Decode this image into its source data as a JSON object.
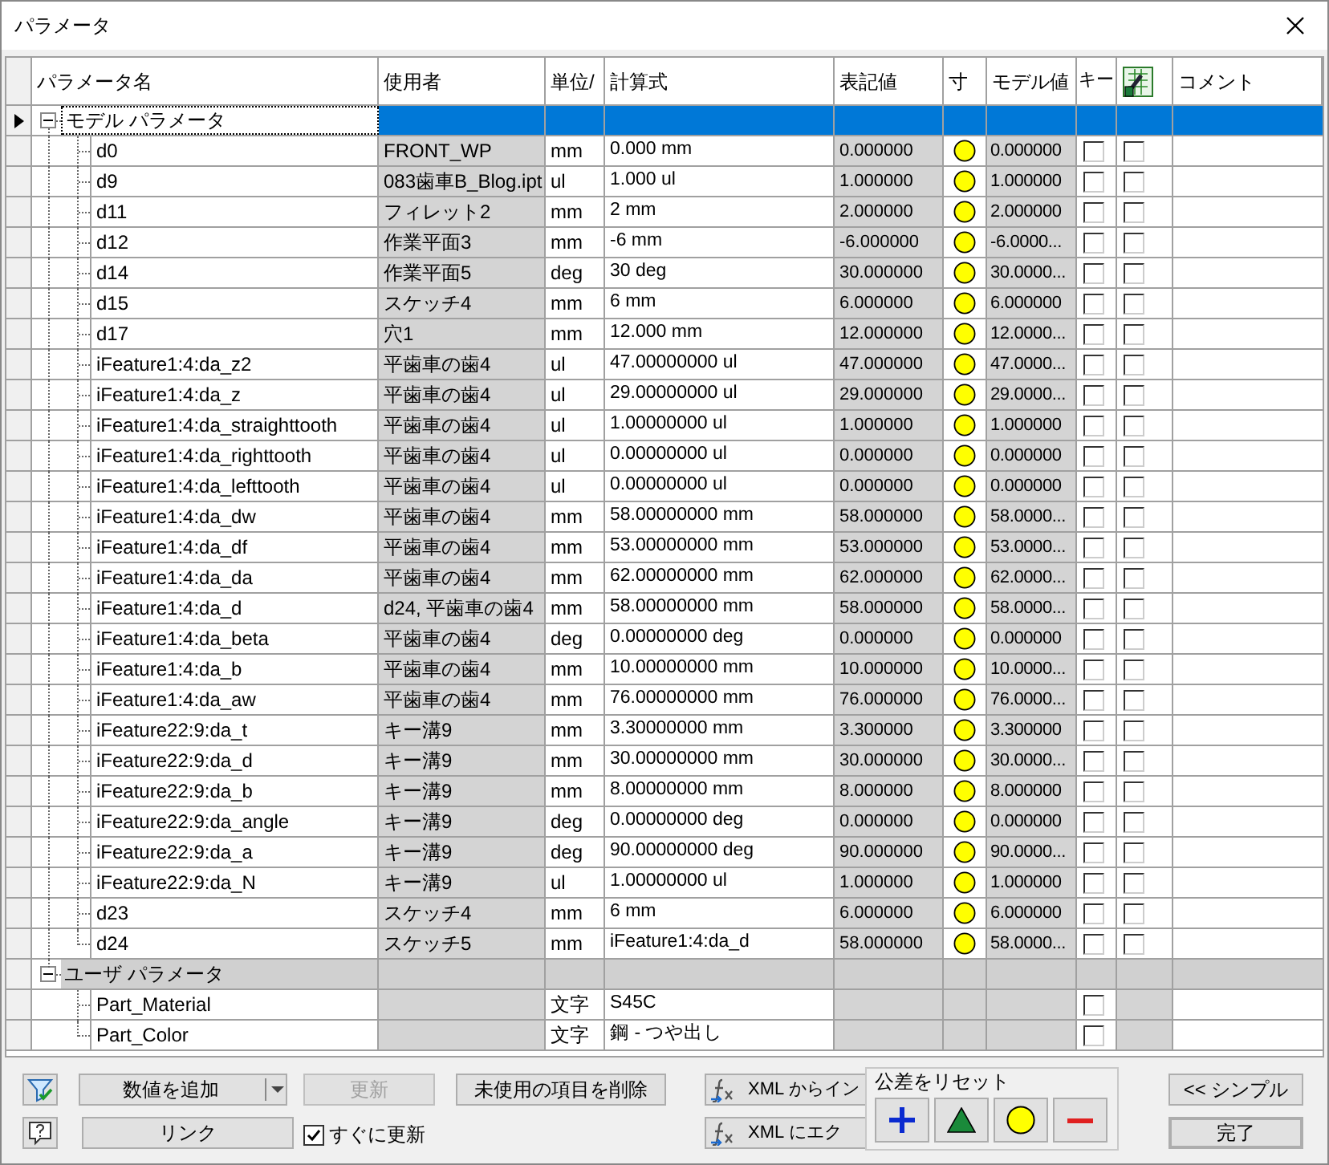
{
  "window": {
    "title": "パラメータ"
  },
  "columns": [
    {
      "label": "パラメータ名"
    },
    {
      "label": "使用者"
    },
    {
      "label": "単位/"
    },
    {
      "label": "計算式"
    },
    {
      "label": "表記値"
    },
    {
      "label": "寸"
    },
    {
      "label": "モデル値"
    },
    {
      "label": "キー"
    },
    {
      "kind": "export_icon"
    },
    {
      "label": "コメント"
    }
  ],
  "groups": [
    {
      "label": "モデル パラメータ",
      "expanded": true,
      "selected": true,
      "rows": [
        {
          "kind": "numeric",
          "name": "d0",
          "user": "FRONT_WP",
          "unit": "mm",
          "formula": "0.000 mm",
          "display_value": "0.000000",
          "model_value": "0.000000",
          "key": false,
          "export": false
        },
        {
          "kind": "numeric",
          "name": "d9",
          "user": "083歯車B_Blog.ipt",
          "unit": "ul",
          "formula": "1.000 ul",
          "display_value": "1.000000",
          "model_value": "1.000000",
          "key": false,
          "export": false
        },
        {
          "kind": "numeric",
          "name": "d11",
          "user": "フィレット2",
          "unit": "mm",
          "formula": "2 mm",
          "display_value": "2.000000",
          "model_value": "2.000000",
          "key": false,
          "export": false
        },
        {
          "kind": "numeric",
          "name": "d12",
          "user": "作業平面3",
          "unit": "mm",
          "formula": "-6 mm",
          "display_value": "-6.000000",
          "model_value": "-6.0000...",
          "key": false,
          "export": false
        },
        {
          "kind": "numeric",
          "name": "d14",
          "user": "作業平面5",
          "unit": "deg",
          "formula": "30 deg",
          "display_value": "30.000000",
          "model_value": "30.0000...",
          "key": false,
          "export": false
        },
        {
          "kind": "numeric",
          "name": "d15",
          "user": "スケッチ4",
          "unit": "mm",
          "formula": "6 mm",
          "display_value": "6.000000",
          "model_value": "6.000000",
          "key": false,
          "export": false
        },
        {
          "kind": "numeric",
          "name": "d17",
          "user": "穴1",
          "unit": "mm",
          "formula": "12.000 mm",
          "display_value": "12.000000",
          "model_value": "12.0000...",
          "key": false,
          "export": false
        },
        {
          "kind": "numeric",
          "name": "iFeature1:4:da_z2",
          "user": "平歯車の歯4",
          "unit": "ul",
          "formula": "47.00000000 ul",
          "display_value": "47.000000",
          "model_value": "47.0000...",
          "key": false,
          "export": false
        },
        {
          "kind": "numeric",
          "name": "iFeature1:4:da_z",
          "user": "平歯車の歯4",
          "unit": "ul",
          "formula": "29.00000000 ul",
          "display_value": "29.000000",
          "model_value": "29.0000...",
          "key": false,
          "export": false
        },
        {
          "kind": "numeric",
          "name": "iFeature1:4:da_straighttooth",
          "user": "平歯車の歯4",
          "unit": "ul",
          "formula": "1.00000000 ul",
          "display_value": "1.000000",
          "model_value": "1.000000",
          "key": false,
          "export": false
        },
        {
          "kind": "numeric",
          "name": "iFeature1:4:da_righttooth",
          "user": "平歯車の歯4",
          "unit": "ul",
          "formula": "0.00000000 ul",
          "display_value": "0.000000",
          "model_value": "0.000000",
          "key": false,
          "export": false
        },
        {
          "kind": "numeric",
          "name": "iFeature1:4:da_lefttooth",
          "user": "平歯車の歯4",
          "unit": "ul",
          "formula": "0.00000000 ul",
          "display_value": "0.000000",
          "model_value": "0.000000",
          "key": false,
          "export": false
        },
        {
          "kind": "numeric",
          "name": "iFeature1:4:da_dw",
          "user": "平歯車の歯4",
          "unit": "mm",
          "formula": "58.00000000 mm",
          "display_value": "58.000000",
          "model_value": "58.0000...",
          "key": false,
          "export": false
        },
        {
          "kind": "numeric",
          "name": "iFeature1:4:da_df",
          "user": "平歯車の歯4",
          "unit": "mm",
          "formula": "53.00000000 mm",
          "display_value": "53.000000",
          "model_value": "53.0000...",
          "key": false,
          "export": false
        },
        {
          "kind": "numeric",
          "name": "iFeature1:4:da_da",
          "user": "平歯車の歯4",
          "unit": "mm",
          "formula": "62.00000000 mm",
          "display_value": "62.000000",
          "model_value": "62.0000...",
          "key": false,
          "export": false
        },
        {
          "kind": "numeric",
          "name": "iFeature1:4:da_d",
          "user": "d24, 平歯車の歯4",
          "unit": "mm",
          "formula": "58.00000000 mm",
          "display_value": "58.000000",
          "model_value": "58.0000...",
          "key": false,
          "export": false
        },
        {
          "kind": "numeric",
          "name": "iFeature1:4:da_beta",
          "user": "平歯車の歯4",
          "unit": "deg",
          "formula": "0.00000000 deg",
          "display_value": "0.000000",
          "model_value": "0.000000",
          "key": false,
          "export": false
        },
        {
          "kind": "numeric",
          "name": "iFeature1:4:da_b",
          "user": "平歯車の歯4",
          "unit": "mm",
          "formula": "10.00000000 mm",
          "display_value": "10.000000",
          "model_value": "10.0000...",
          "key": false,
          "export": false
        },
        {
          "kind": "numeric",
          "name": "iFeature1:4:da_aw",
          "user": "平歯車の歯4",
          "unit": "mm",
          "formula": "76.00000000 mm",
          "display_value": "76.000000",
          "model_value": "76.0000...",
          "key": false,
          "export": false
        },
        {
          "kind": "numeric",
          "name": "iFeature22:9:da_t",
          "user": "キー溝9",
          "unit": "mm",
          "formula": "3.30000000 mm",
          "display_value": "3.300000",
          "model_value": "3.300000",
          "key": false,
          "export": false
        },
        {
          "kind": "numeric",
          "name": "iFeature22:9:da_d",
          "user": "キー溝9",
          "unit": "mm",
          "formula": "30.00000000 mm",
          "display_value": "30.000000",
          "model_value": "30.0000...",
          "key": false,
          "export": false
        },
        {
          "kind": "numeric",
          "name": "iFeature22:9:da_b",
          "user": "キー溝9",
          "unit": "mm",
          "formula": "8.00000000 mm",
          "display_value": "8.000000",
          "model_value": "8.000000",
          "key": false,
          "export": false
        },
        {
          "kind": "numeric",
          "name": "iFeature22:9:da_angle",
          "user": "キー溝9",
          "unit": "deg",
          "formula": "0.00000000 deg",
          "display_value": "0.000000",
          "model_value": "0.000000",
          "key": false,
          "export": false
        },
        {
          "kind": "numeric",
          "name": "iFeature22:9:da_a",
          "user": "キー溝9",
          "unit": "deg",
          "formula": "90.00000000 deg",
          "display_value": "90.000000",
          "model_value": "90.0000...",
          "key": false,
          "export": false
        },
        {
          "kind": "numeric",
          "name": "iFeature22:9:da_N",
          "user": "キー溝9",
          "unit": "ul",
          "formula": "1.00000000 ul",
          "display_value": "1.000000",
          "model_value": "1.000000",
          "key": false,
          "export": false
        },
        {
          "kind": "numeric",
          "name": "d23",
          "user": "スケッチ4",
          "unit": "mm",
          "formula": "6 mm",
          "display_value": "6.000000",
          "model_value": "6.000000",
          "key": false,
          "export": false
        },
        {
          "kind": "numeric",
          "name": "d24",
          "user": "スケッチ5",
          "unit": "mm",
          "formula": "iFeature1:4:da_d",
          "display_value": "58.000000",
          "model_value": "58.0000...",
          "key": false,
          "export": false
        }
      ]
    },
    {
      "label": "ユーザ パラメータ",
      "expanded": true,
      "selected": false,
      "rows": [
        {
          "kind": "text",
          "name": "Part_Material",
          "unit": "文字",
          "formula": "S45C",
          "key": false
        },
        {
          "kind": "text",
          "name": "Part_Color",
          "unit": "文字",
          "formula": "鋼 - つや出し",
          "key": false
        }
      ]
    }
  ],
  "buttons": {
    "filter": {
      "kind": "filter_icon"
    },
    "add_value": "数値を追加",
    "update": {
      "label": "更新",
      "disabled": true
    },
    "purge": "未使用の項目を削除",
    "import_xml": "XML からイン",
    "simple": "<< シンプル",
    "help": {
      "kind": "help_icon"
    },
    "link": "リンク",
    "immediate_update": {
      "label": "すぐに更新",
      "checked": true
    },
    "export_xml": "XML にエク",
    "done": "完了"
  },
  "tolerance_popup": {
    "title": "公差をリセット",
    "buttons": [
      {
        "kind": "upper"
      },
      {
        "kind": "median"
      },
      {
        "kind": "nominal"
      },
      {
        "kind": "lower"
      }
    ]
  }
}
